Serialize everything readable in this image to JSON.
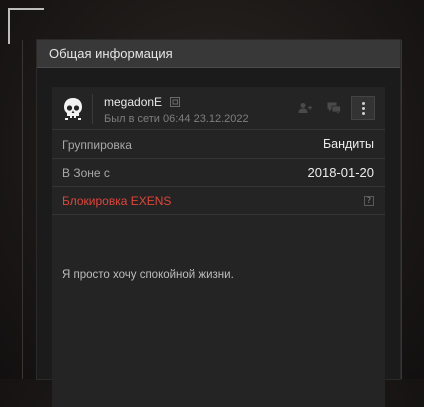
{
  "panel": {
    "title": "Общая информация"
  },
  "profile": {
    "username": "megadonE",
    "last_seen": "Был в сети 06:44 23.12.2022",
    "avatar_icon": "skull-icon",
    "actions": {
      "add_friend_icon": "add-friend-icon",
      "chat_icon": "chat-icon",
      "more_icon": "more-vertical-icon"
    }
  },
  "info": {
    "group_label": "Группировка",
    "group_value": "Бандиты",
    "zone_label": "В Зоне с",
    "zone_value": "2018-01-20",
    "block_label": "Блокировка EXENS",
    "block_help": "?"
  },
  "bio": "Я просто хочу спокойной жизни.",
  "colors": {
    "accent_red": "#e0453a",
    "panel_bg": "#1b1b1b",
    "header_bg": "#383838"
  }
}
